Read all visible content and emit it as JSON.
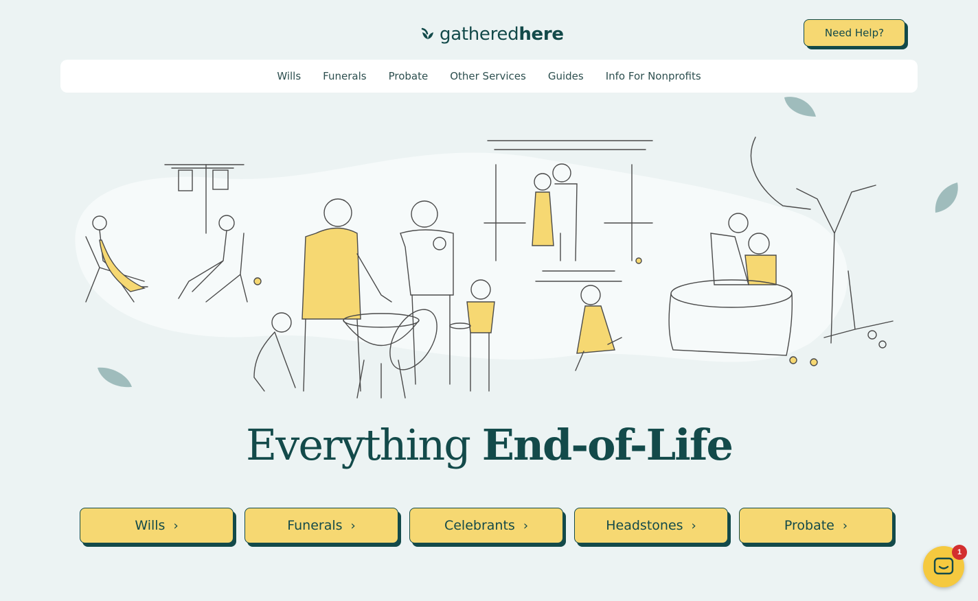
{
  "header": {
    "logo": {
      "part_regular": "gathered",
      "part_bold": "here",
      "icon": "leaf-sprout-icon"
    },
    "help_button": "Need Help?"
  },
  "nav": {
    "items": [
      {
        "label": "Wills"
      },
      {
        "label": "Funerals"
      },
      {
        "label": "Probate"
      },
      {
        "label": "Other Services"
      },
      {
        "label": "Guides"
      },
      {
        "label": "Info For Nonprofits"
      }
    ]
  },
  "hero": {
    "title_regular": "Everything",
    "title_bold": "End-of-Life"
  },
  "cta": {
    "items": [
      {
        "label": "Wills",
        "icon": "chevron-right-icon"
      },
      {
        "label": "Funerals",
        "icon": "chevron-right-icon"
      },
      {
        "label": "Celebrants",
        "icon": "chevron-right-icon"
      },
      {
        "label": "Headstones",
        "icon": "chevron-right-icon"
      },
      {
        "label": "Probate",
        "icon": "chevron-right-icon"
      }
    ]
  },
  "chat_widget": {
    "badge_count": "1",
    "icon": "chat-icon"
  },
  "colors": {
    "accent": "#f6d872",
    "brand_dark": "#134a4a",
    "background": "#ecf3f3"
  }
}
